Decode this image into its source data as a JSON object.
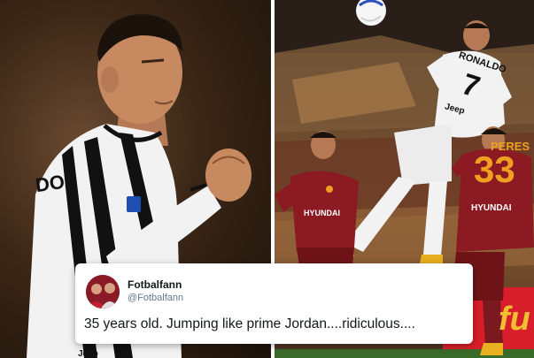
{
  "left_photo": {
    "jersey_text": "DO",
    "kit_sponsor": "Jeep"
  },
  "right_photo": {
    "jumping_player_name": "RONALDO",
    "jumping_player_number": "7",
    "jumping_player_sponsor": "Jeep",
    "defender_name": "PERES",
    "defender_number": "33",
    "defender_sponsor": "HYUNDAI",
    "midfielder_sponsor": "HYUNDAI",
    "board_text": "fu"
  },
  "tweet": {
    "display_name": "Fotbalfann",
    "handle": "@Fotbalfann",
    "text": "35 years old. Jumping like prime Jordan....ridiculous...."
  },
  "colors": {
    "juve_white": "#f2f2f2",
    "juve_black": "#111111",
    "roma_red": "#8c1a22",
    "roma_orange": "#f0a020"
  }
}
